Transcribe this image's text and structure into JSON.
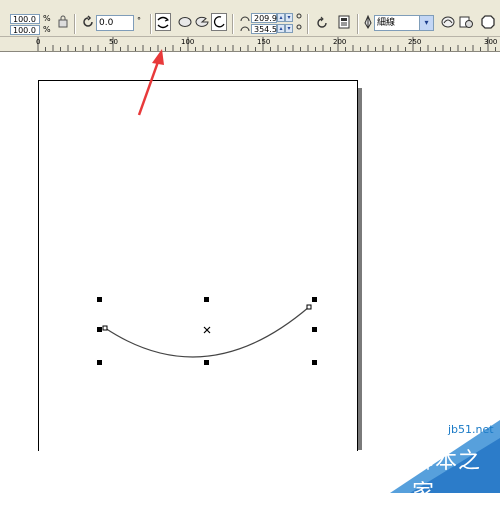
{
  "toolbar": {
    "width_value": "100.0",
    "height_value": "100.0",
    "percent_a": "%",
    "percent_b": "%",
    "rotation_value": "0.0",
    "degree_symbol": "°",
    "start_angle": "209.9",
    "end_angle": "354.5",
    "line_style": "細線",
    "dropdown_arrow": "▾"
  },
  "ruler": {
    "labels": [
      "0",
      "50",
      "100",
      "150",
      "200",
      "250",
      "300"
    ]
  },
  "watermark": {
    "url": "jb51.net",
    "site_name": "脚本之家"
  },
  "colors": {
    "arrow": "#e8393a",
    "toolbar_bg": "#ece9d8",
    "watermark_blue": "#1a7ac6"
  }
}
